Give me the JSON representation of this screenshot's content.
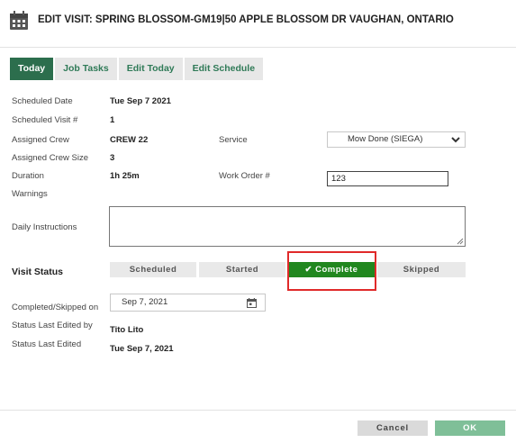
{
  "header": {
    "title": "EDIT VISIT: SPRING BLOSSOM-GM19|50 APPLE BLOSSOM DR VAUGHAN, ONTARIO"
  },
  "tabs": [
    {
      "label": "Today",
      "active": true
    },
    {
      "label": "Job Tasks",
      "active": false
    },
    {
      "label": "Edit Today",
      "active": false
    },
    {
      "label": "Edit Schedule",
      "active": false
    }
  ],
  "fields": {
    "scheduled_date": {
      "label": "Scheduled Date",
      "value": "Tue Sep 7 2021"
    },
    "scheduled_visit": {
      "label": "Scheduled Visit #",
      "value": "1"
    },
    "assigned_crew": {
      "label": "Assigned Crew",
      "value": "CREW 22"
    },
    "service": {
      "label": "Service",
      "value": "Mow Done (SIEGA)"
    },
    "assigned_crew_size": {
      "label": "Assigned Crew Size",
      "value": "3"
    },
    "duration": {
      "label": "Duration",
      "value": "1h 25m"
    },
    "work_order": {
      "label": "Work Order #",
      "value": "123"
    },
    "warnings": {
      "label": "Warnings"
    },
    "daily_instructions": {
      "label": "Daily Instructions",
      "value": ""
    }
  },
  "visit_status": {
    "label": "Visit Status",
    "options": [
      "Scheduled",
      "Started",
      "✔ Complete",
      "Skipped"
    ],
    "selected": "✔ Complete"
  },
  "completion": {
    "completed_on": {
      "label": "Completed/Skipped on",
      "value": "Sep 7, 2021"
    },
    "last_edited_by": {
      "label": "Status Last Edited by",
      "value": "Tito Lito"
    },
    "last_edited": {
      "label": "Status Last Edited",
      "value": "Tue Sep 7, 2021"
    }
  },
  "footer": {
    "cancel_label": "Cancel",
    "ok_label": "OK"
  },
  "colors": {
    "tab_active": "#2c6e4d",
    "complete": "#21871f",
    "ok": "#7fbf98",
    "highlight": "#e02a2a"
  },
  "icons": [
    "calendar-icon",
    "chevron-down-icon",
    "resize-grip-icon",
    "date-picker-icon"
  ]
}
